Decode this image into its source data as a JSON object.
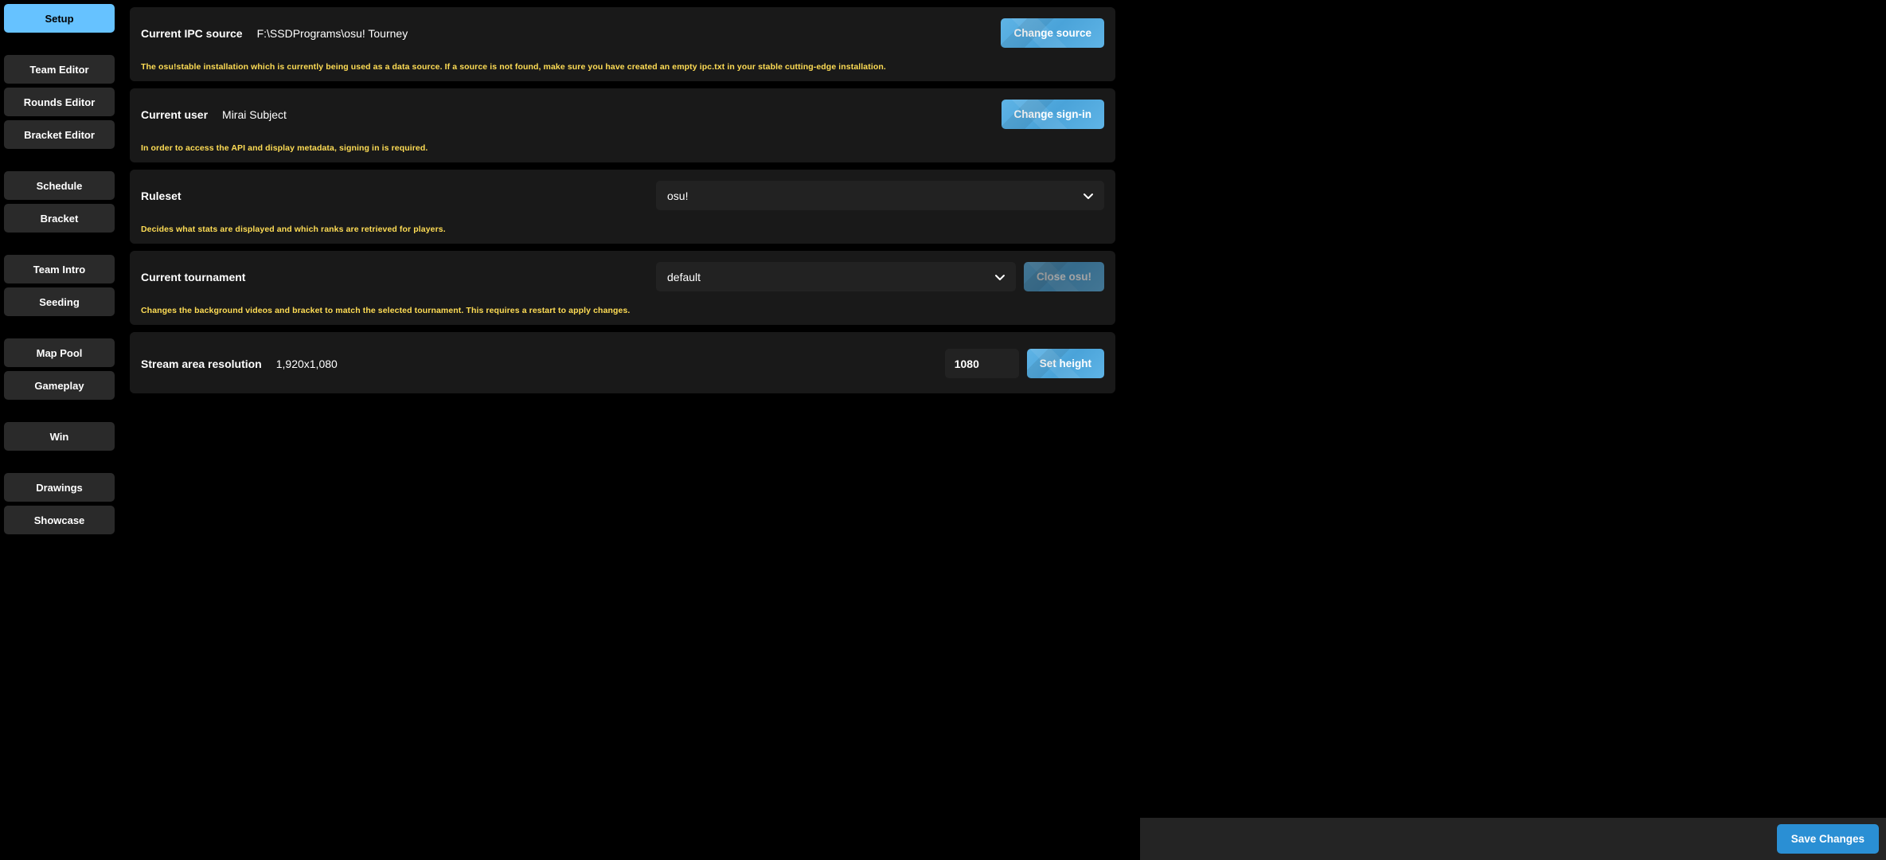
{
  "sidebar": {
    "groups": [
      [
        {
          "label": "Setup",
          "active": true
        }
      ],
      [
        {
          "label": "Team Editor"
        },
        {
          "label": "Rounds Editor"
        },
        {
          "label": "Bracket Editor"
        }
      ],
      [
        {
          "label": "Schedule"
        },
        {
          "label": "Bracket"
        }
      ],
      [
        {
          "label": "Team Intro"
        },
        {
          "label": "Seeding"
        }
      ],
      [
        {
          "label": "Map Pool"
        },
        {
          "label": "Gameplay"
        }
      ],
      [
        {
          "label": "Win"
        }
      ],
      [
        {
          "label": "Drawings"
        },
        {
          "label": "Showcase"
        }
      ]
    ]
  },
  "cards": {
    "ipc": {
      "label": "Current IPC source",
      "value": "F:\\SSDPrograms\\osu! Tourney",
      "help": "The osu!stable installation which is currently being used as a data source. If a source is not found, make sure you have created an empty ipc.txt in your stable cutting-edge installation.",
      "button": "Change source"
    },
    "user": {
      "label": "Current user",
      "value": "Mirai Subject",
      "help": "In order to access the API and display metadata, signing in is required.",
      "button": "Change sign-in"
    },
    "ruleset": {
      "label": "Ruleset",
      "value": "osu!",
      "help": "Decides what stats are displayed and which ranks are retrieved for players."
    },
    "tournament": {
      "label": "Current tournament",
      "value": "default",
      "help": "Changes the background videos and bracket to match the selected tournament. This requires a restart to apply changes.",
      "button": "Close osu!"
    },
    "resolution": {
      "label": "Stream area resolution",
      "value": "1,920x1,080",
      "input_value": "1080",
      "button": "Set height"
    }
  },
  "save_button": "Save Changes"
}
